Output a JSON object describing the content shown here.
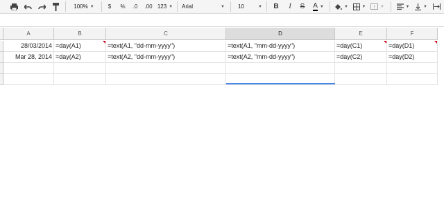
{
  "toolbar": {
    "zoom": "100%",
    "currency": "$",
    "percent": "%",
    "dec_decrease": ".0",
    "dec_increase": ".00",
    "more_formats": "123",
    "font": "Arial",
    "font_size": "10",
    "bold": "B",
    "italic": "I",
    "strikethrough": "S",
    "text_color": "A"
  },
  "columns": [
    "A",
    "B",
    "C",
    "D",
    "E",
    "F"
  ],
  "selected_column": "D",
  "rows": [
    {
      "A": "28/03/2014",
      "B": "=day(A1)",
      "C": "=text(A1, \"dd-mm-yyyy\")",
      "D": "=text(A1, \"mm-dd-yyyy\")",
      "E": "=day(C1)",
      "F": "=day(D1)"
    },
    {
      "A": "Mar 28, 2014",
      "B": "=day(A2)",
      "C": "=text(A2, \"dd-mm-yyyy\")",
      "D": "=text(A2, \"mm-dd-yyyy\")",
      "E": "=day(C2)",
      "F": "=day(D2)"
    }
  ],
  "colors": {
    "selection": "#4a86e8",
    "error_marker": "#d0021b"
  }
}
